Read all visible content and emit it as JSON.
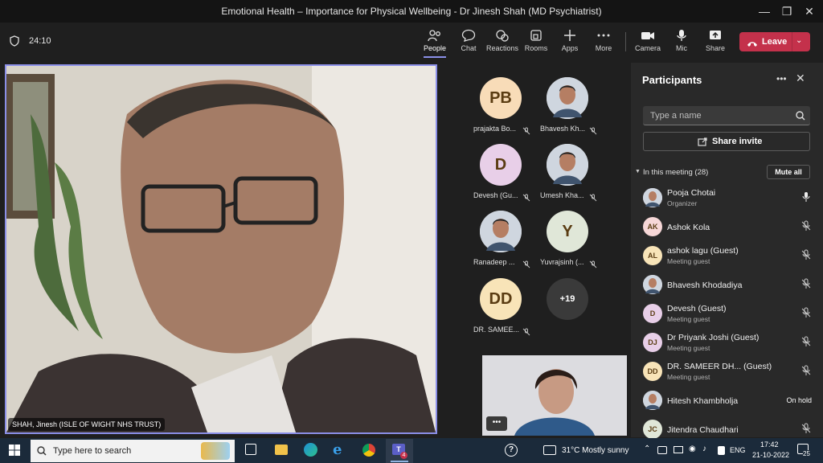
{
  "window": {
    "title": "Emotional Health – Importance for Physical Wellbeing - Dr Jinesh Shah (MD Psychiatrist)"
  },
  "meeting": {
    "timer": "24:10"
  },
  "toolbar": {
    "items": [
      {
        "label": "People",
        "icon": "people-icon"
      },
      {
        "label": "Chat",
        "icon": "chat-icon"
      },
      {
        "label": "Reactions",
        "icon": "reactions-icon"
      },
      {
        "label": "Rooms",
        "icon": "rooms-icon"
      },
      {
        "label": "Apps",
        "icon": "plus-icon"
      },
      {
        "label": "More",
        "icon": "more-icon"
      }
    ],
    "devices": [
      {
        "label": "Camera",
        "icon": "camera-icon"
      },
      {
        "label": "Mic",
        "icon": "mic-icon"
      },
      {
        "label": "Share",
        "icon": "share-icon"
      }
    ],
    "leave_label": "Leave"
  },
  "main_video": {
    "name": "SHAH, Jinesh (ISLE OF WIGHT NHS TRUST)"
  },
  "tiles": [
    {
      "initials": "PB",
      "name": "prajakta Bo...",
      "color": "#f8dcb8"
    },
    {
      "initials": "",
      "name": "Bhavesh Kh...",
      "color": "#d9d9d9"
    },
    {
      "initials": "D",
      "name": "Devesh (Gu...",
      "color": "#e8cfe8"
    },
    {
      "initials": "",
      "name": "Umesh Kha...",
      "color": "#d9d9d9"
    },
    {
      "initials": "",
      "name": "Ranadeep ...",
      "color": "#d9d9d9"
    },
    {
      "initials": "Y",
      "name": "Yuvrajsinh (...",
      "color": "#e0e7d8"
    },
    {
      "initials": "DD",
      "name": "DR. SAMEE...",
      "color": "#f8e4b8"
    }
  ],
  "overflow_count": "+19",
  "panel": {
    "title": "Participants",
    "search_placeholder": "Type a name",
    "share_invite": "Share invite",
    "section": "In this meeting (28)",
    "mute_all": "Mute all",
    "participants": [
      {
        "initials": "",
        "name": "Pooja Chotai",
        "sub": "Organizer",
        "status": "mic",
        "color": "#d9c8e0"
      },
      {
        "initials": "AK",
        "name": "Ashok Kola",
        "sub": "",
        "status": "mic-off",
        "color": "#f6d7d7"
      },
      {
        "initials": "AL",
        "name": "ashok lagu (Guest)",
        "sub": "Meeting guest",
        "status": "mic-off",
        "color": "#f8e4b8"
      },
      {
        "initials": "",
        "name": "Bhavesh Khodadiya",
        "sub": "",
        "status": "mic-off",
        "color": "#c9c9c9"
      },
      {
        "initials": "D",
        "name": "Devesh (Guest)",
        "sub": "Meeting guest",
        "status": "mic-off",
        "color": "#e8cfe8"
      },
      {
        "initials": "DJ",
        "name": "Dr Priyank Joshi (Guest)",
        "sub": "Meeting guest",
        "status": "mic-off",
        "color": "#e8cfe8"
      },
      {
        "initials": "DD",
        "name": "DR. SAMEER DH...  (Guest)",
        "sub": "Meeting guest",
        "status": "mic-off",
        "color": "#f8e4b8"
      },
      {
        "initials": "",
        "name": "Hitesh Khambholja",
        "sub": "",
        "status": "On hold",
        "color": "#c9c9c9"
      },
      {
        "initials": "JC",
        "name": "Jitendra Chaudhari",
        "sub": "",
        "status": "mic-off",
        "color": "#e0e7d8"
      }
    ]
  },
  "taskbar": {
    "search_placeholder": "Type here to search",
    "weather": "31°C  Mostly sunny",
    "language": "ENG",
    "time": "17:42",
    "date": "21-10-2022",
    "notifications": "25",
    "teams_badge": "4"
  }
}
